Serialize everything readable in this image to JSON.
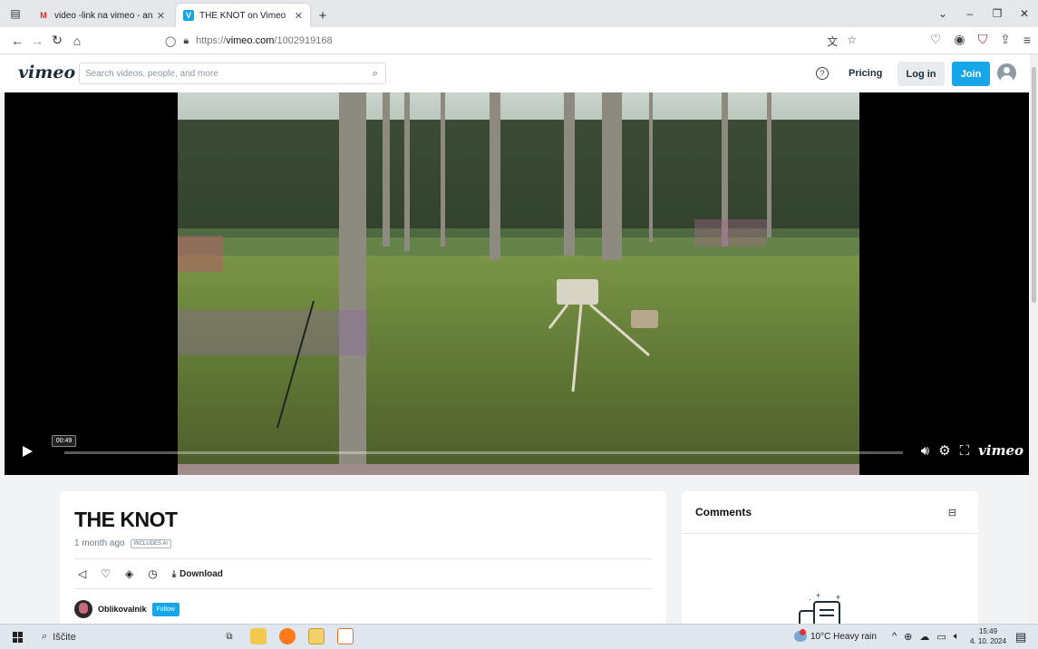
{
  "browser": {
    "tabs": [
      {
        "title": "video -link na vimeo - anzekrec",
        "favicon": "gmail-icon",
        "active": false
      },
      {
        "title": "THE KNOT on Vimeo",
        "favicon": "vimeo-icon",
        "active": true
      }
    ],
    "url_prefix": "https://",
    "url_host": "vimeo.com",
    "url_path": "/1002919168"
  },
  "vimeo": {
    "logo": "vimeo",
    "search_placeholder": "Search videos, people, and more",
    "help": "?",
    "pricing": "Pricing",
    "login": "Log in",
    "join": "Join"
  },
  "player": {
    "time": "00:49",
    "brand": "vimeo",
    "progress": 0.0
  },
  "video": {
    "title": "THE KNOT",
    "uploaded": "1 month ago",
    "badge": "INCLUDES AI",
    "download_label": "Download",
    "creator_name": "Oblikovalnik",
    "follow_label": "Follow"
  },
  "comments": {
    "title": "Comments"
  },
  "taskbar": {
    "search_label": "Iščite",
    "weather": "10°C  Heavy rain",
    "time": "15:49",
    "date": "4. 10. 2024"
  },
  "colors": {
    "accent": "#17a6e8",
    "vimeo_dark": "#1a2e3b"
  }
}
